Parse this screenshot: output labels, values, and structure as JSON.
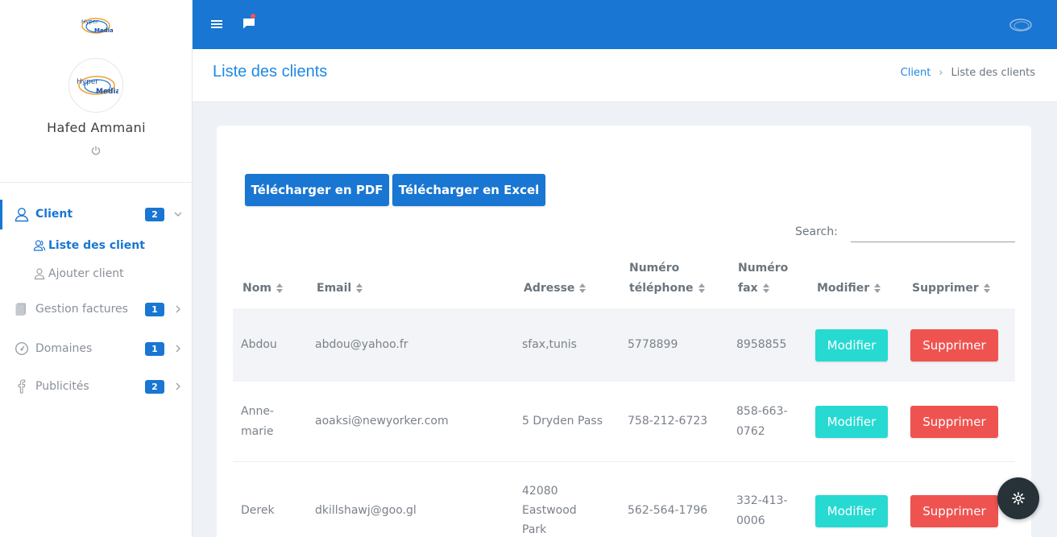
{
  "sidebar": {
    "user_name": "Hafed Ammani",
    "logo_text": "Hyper Media",
    "menu": [
      {
        "label": "Client",
        "badge": "2",
        "icon": "user-icon",
        "active": true
      },
      {
        "label": "Gestion factures",
        "badge": "1",
        "icon": "file-icon"
      },
      {
        "label": "Domaines",
        "badge": "1",
        "icon": "gauge-icon"
      },
      {
        "label": "Publicités",
        "badge": "2",
        "icon": "facebook-icon"
      }
    ],
    "submenu": [
      {
        "label": "Liste des client",
        "icon": "users-icon",
        "active": true
      },
      {
        "label": "Ajouter client",
        "icon": "user-icon"
      }
    ]
  },
  "topbar": {
    "accent": "#1976d2"
  },
  "header": {
    "title": "Liste des clients",
    "breadcrumb": {
      "parent": "Client",
      "current": "Liste des clients"
    }
  },
  "toolbar": {
    "pdf_label": "Télécharger en PDF",
    "excel_label": "Télécharger en Excel"
  },
  "search": {
    "label": "Search:",
    "value": ""
  },
  "table": {
    "columns": {
      "nom": "Nom",
      "email": "Email",
      "adresse": "Adresse",
      "tel_1": "Numéro",
      "tel_2": "téléphone",
      "fax_1": "Numéro",
      "fax_2": "fax",
      "modifier": "Modifier",
      "supprimer": "Supprimer"
    },
    "rows": [
      {
        "nom": [
          "Abdou"
        ],
        "email": "abdou@yahoo.fr",
        "adresse": [
          "sfax,tunis"
        ],
        "tel": "5778899",
        "fax": [
          "8958855"
        ],
        "modifier": "Modifier",
        "supprimer": "Supprimer"
      },
      {
        "nom": [
          "Anne-",
          "marie"
        ],
        "email": "aoaksi@newyorker.com",
        "adresse": [
          "5 Dryden Pass"
        ],
        "tel": "758-212-6723",
        "fax": [
          "858-663-",
          "0762"
        ],
        "modifier": "Modifier",
        "supprimer": "Supprimer"
      },
      {
        "nom": [
          "Derek"
        ],
        "email": "dkillshawj@goo.gl",
        "adresse": [
          "42080",
          "Eastwood",
          "Park"
        ],
        "tel": "562-564-1796",
        "fax": [
          "332-413-",
          "0006"
        ],
        "modifier": "Modifier",
        "supprimer": "Supprimer"
      }
    ]
  },
  "colors": {
    "primary": "#1976d2",
    "success": "#26dad2",
    "danger": "#ef5350",
    "fab": "#263238"
  }
}
